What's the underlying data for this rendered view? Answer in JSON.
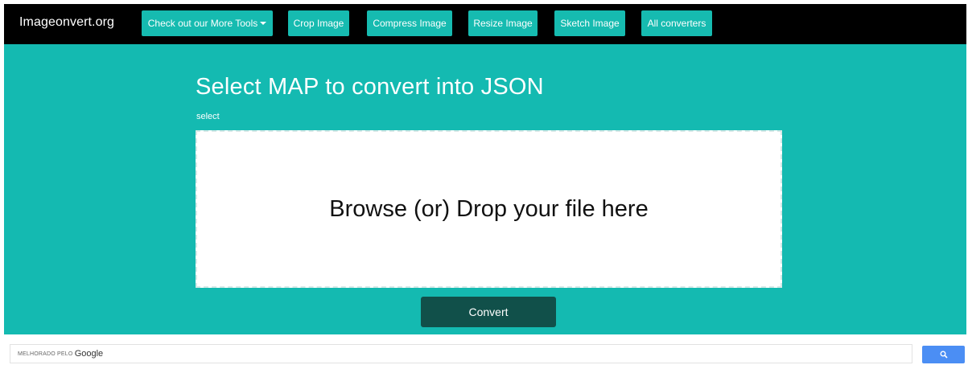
{
  "navbar": {
    "brand": "Imageonvert.org",
    "items": [
      {
        "label": "Check out our More Tools",
        "has_dropdown": true
      },
      {
        "label": "Crop Image"
      },
      {
        "label": "Compress Image"
      },
      {
        "label": "Resize Image"
      },
      {
        "label": "Sketch Image"
      },
      {
        "label": "All converters"
      }
    ]
  },
  "main": {
    "heading": "Select MAP to convert into JSON",
    "sub_label": "select",
    "dropzone_text": "Browse (or) Drop your file here",
    "convert_label": "Convert"
  },
  "search": {
    "placeholder_prefix": "MELHORADO PELO",
    "placeholder_brand": "Google",
    "button_icon": "search-icon"
  },
  "colors": {
    "accent": "#14bab1",
    "nav_button": "#16bbb0",
    "navbar_bg": "#000000",
    "convert_bg": "#11504a",
    "search_button": "#4b8ef4"
  }
}
